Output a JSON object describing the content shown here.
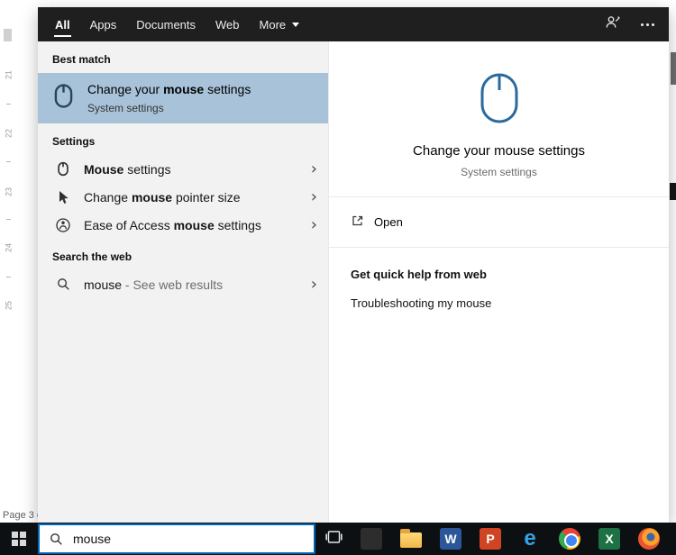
{
  "background": {
    "ruler_marks": [
      "21",
      "22",
      "23",
      "24",
      "25"
    ],
    "page_status": "Page 3 o"
  },
  "flyout": {
    "tabs": {
      "all": "All",
      "apps": "Apps",
      "documents": "Documents",
      "web": "Web",
      "more": "More"
    },
    "left": {
      "best_match_label": "Best match",
      "best_match": {
        "pre": "Change your ",
        "bold": "mouse",
        "post": " settings",
        "subtitle": "System settings"
      },
      "settings_label": "Settings",
      "settings_items": [
        {
          "pre": "",
          "bold": "Mouse",
          "post": " settings"
        },
        {
          "pre": "Change ",
          "bold": "mouse",
          "post": " pointer size"
        },
        {
          "pre": "Ease of Access ",
          "bold": "mouse",
          "post": " settings"
        }
      ],
      "web_label": "Search the web",
      "web_item": {
        "query": "mouse",
        "suffix": " - See web results"
      }
    },
    "right": {
      "title": "Change your mouse settings",
      "subtitle": "System settings",
      "open_label": "Open",
      "help_header": "Get quick help from web",
      "help_link": "Troubleshooting my mouse"
    }
  },
  "taskbar": {
    "search_value": "mouse",
    "app_icons": [
      "store",
      "file-explorer",
      "word",
      "powerpoint",
      "edge",
      "chrome",
      "excel",
      "firefox"
    ]
  },
  "colors": {
    "accent": "#0067b8",
    "highlight": "#a8c3d9",
    "header_bg": "#1f1f1f",
    "left_panel_bg": "#f2f2f2",
    "mouse_icon_blue": "#2b6a9e"
  }
}
